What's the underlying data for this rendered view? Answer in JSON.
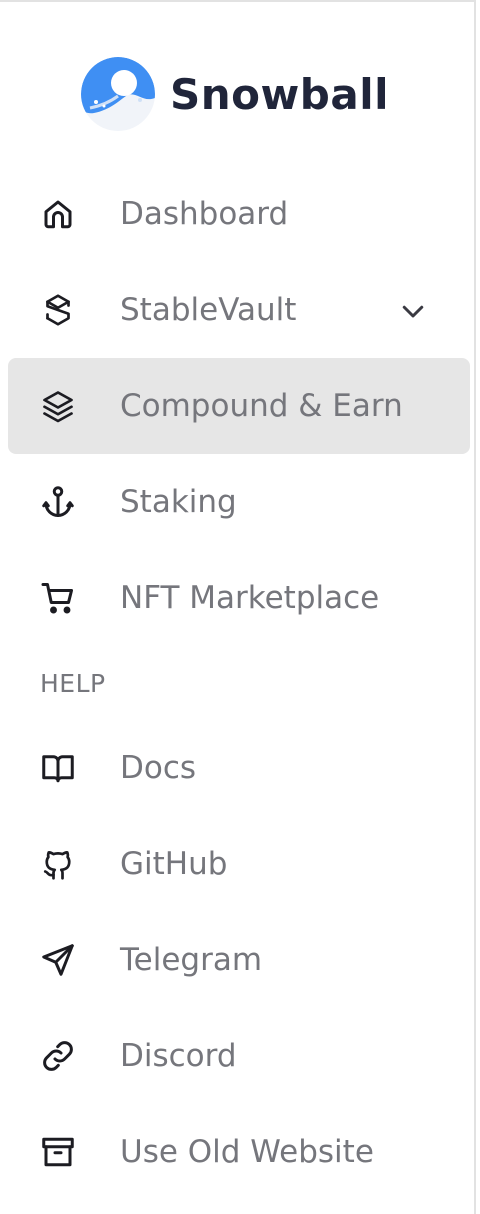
{
  "brand": {
    "name": "Snowball",
    "logo_icon": "snowball-logo",
    "colors": {
      "logo_blue": "#3f8ff3",
      "logo_text": "#20253a",
      "label": "#75767c",
      "active_bg": "#e6e6e6"
    }
  },
  "nav": {
    "items": [
      {
        "label": "Dashboard",
        "icon": "home-icon"
      },
      {
        "label": "StableVault",
        "icon": "stablevault-icon",
        "expandable": true
      },
      {
        "label": "Compound & Earn",
        "icon": "layers-icon",
        "active": true
      },
      {
        "label": "Staking",
        "icon": "anchor-icon"
      },
      {
        "label": "NFT Marketplace",
        "icon": "cart-icon"
      }
    ]
  },
  "help": {
    "header": "HELP",
    "items": [
      {
        "label": "Docs",
        "icon": "book-icon"
      },
      {
        "label": "GitHub",
        "icon": "github-icon"
      },
      {
        "label": "Telegram",
        "icon": "send-icon"
      },
      {
        "label": "Discord",
        "icon": "link-icon"
      },
      {
        "label": "Use Old Website",
        "icon": "archive-icon"
      }
    ]
  }
}
